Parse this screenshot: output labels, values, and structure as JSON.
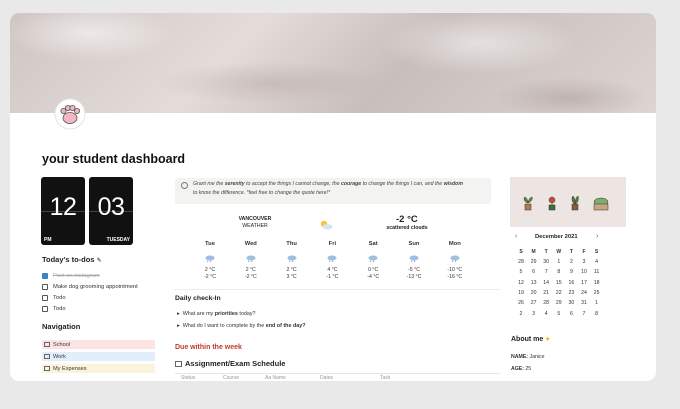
{
  "page": {
    "title": "your student dashboard"
  },
  "clock": {
    "hour": "12",
    "minute": "03",
    "period": "PM",
    "weekday": "TUESDAY"
  },
  "todos": {
    "heading": "Today's to-dos",
    "items": [
      {
        "label": "Post on instagram",
        "checked": true
      },
      {
        "label": "Make dog grooming appointment",
        "checked": false
      },
      {
        "label": "Todo",
        "checked": false
      },
      {
        "label": "Todo",
        "checked": false
      }
    ]
  },
  "navigation": {
    "heading": "Navigation",
    "items": [
      {
        "label": "School",
        "color": "#fde4e4"
      },
      {
        "label": "Work",
        "color": "#e3eefb"
      },
      {
        "label": "My Expenses",
        "color": "#fbf3db"
      }
    ]
  },
  "quote": {
    "line1_pre": "Grant me the ",
    "w1": "serenity",
    "line1_mid": " to accept the things I cannot change, the ",
    "w2": "courage",
    "line1_mid2": " to change the things I can, and the ",
    "w3": "wisdom",
    "line2": "to know the difference. *feel free to change the quote here!*"
  },
  "weather": {
    "city": "VANCOUVER",
    "label": "WEATHER",
    "current_temp": "-2 °C",
    "condition": "scattered clouds",
    "days": [
      {
        "day": "Tue",
        "high": "2 °C",
        "low": "-2 °C",
        "icon": "rain-cloud-icon"
      },
      {
        "day": "Wed",
        "high": "2 °C",
        "low": "-2 °C",
        "icon": "rain-cloud-icon"
      },
      {
        "day": "Thu",
        "high": "2 °C",
        "low": "3 °C",
        "icon": "rain-cloud-icon"
      },
      {
        "day": "Fri",
        "high": "4 °C",
        "low": "-1 °C",
        "icon": "rain-cloud-icon"
      },
      {
        "day": "Sat",
        "high": "0 °C",
        "low": "-4 °C",
        "icon": "rain-cloud-icon"
      },
      {
        "day": "Sun",
        "high": "-5 °C",
        "low": "-13 °C",
        "icon": "rain-cloud-icon"
      },
      {
        "day": "Mon",
        "high": "-10 °C",
        "low": "-16 °C",
        "icon": "rain-cloud-icon"
      }
    ]
  },
  "checkin": {
    "heading": "Daily check-In",
    "q1_pre": "What are my ",
    "q1_bold": "priorities",
    "q1_post": " today?",
    "q2_pre": "What do I want to complete by the ",
    "q2_bold": "end of the day?"
  },
  "due": {
    "heading": "Due within the week",
    "table_title": "Assignment/Exam Schedule",
    "columns": [
      "Status",
      "Course",
      "Aa Name",
      "Dates",
      "Task"
    ]
  },
  "calendar": {
    "month": "December 2021",
    "weekdays": [
      "S",
      "M",
      "T",
      "W",
      "T",
      "F",
      "S"
    ],
    "weeks": [
      [
        "28",
        "29",
        "30",
        "1",
        "2",
        "3",
        "4"
      ],
      [
        "5",
        "6",
        "7",
        "8",
        "9",
        "10",
        "11"
      ],
      [
        "12",
        "13",
        "14",
        "15",
        "16",
        "17",
        "18"
      ],
      [
        "19",
        "20",
        "21",
        "22",
        "23",
        "24",
        "25"
      ],
      [
        "26",
        "27",
        "28",
        "29",
        "30",
        "31",
        "1"
      ],
      [
        "2",
        "3",
        "4",
        "5",
        "6",
        "7",
        "8"
      ]
    ]
  },
  "about": {
    "heading": "About me",
    "name_label": "NAME:",
    "name": "Janice",
    "age_label": "AGE:",
    "age": "25"
  },
  "colors": {
    "accent": "#c0392b",
    "checkbox": "#3b82c4",
    "plants_bg": "#ede5e1"
  }
}
